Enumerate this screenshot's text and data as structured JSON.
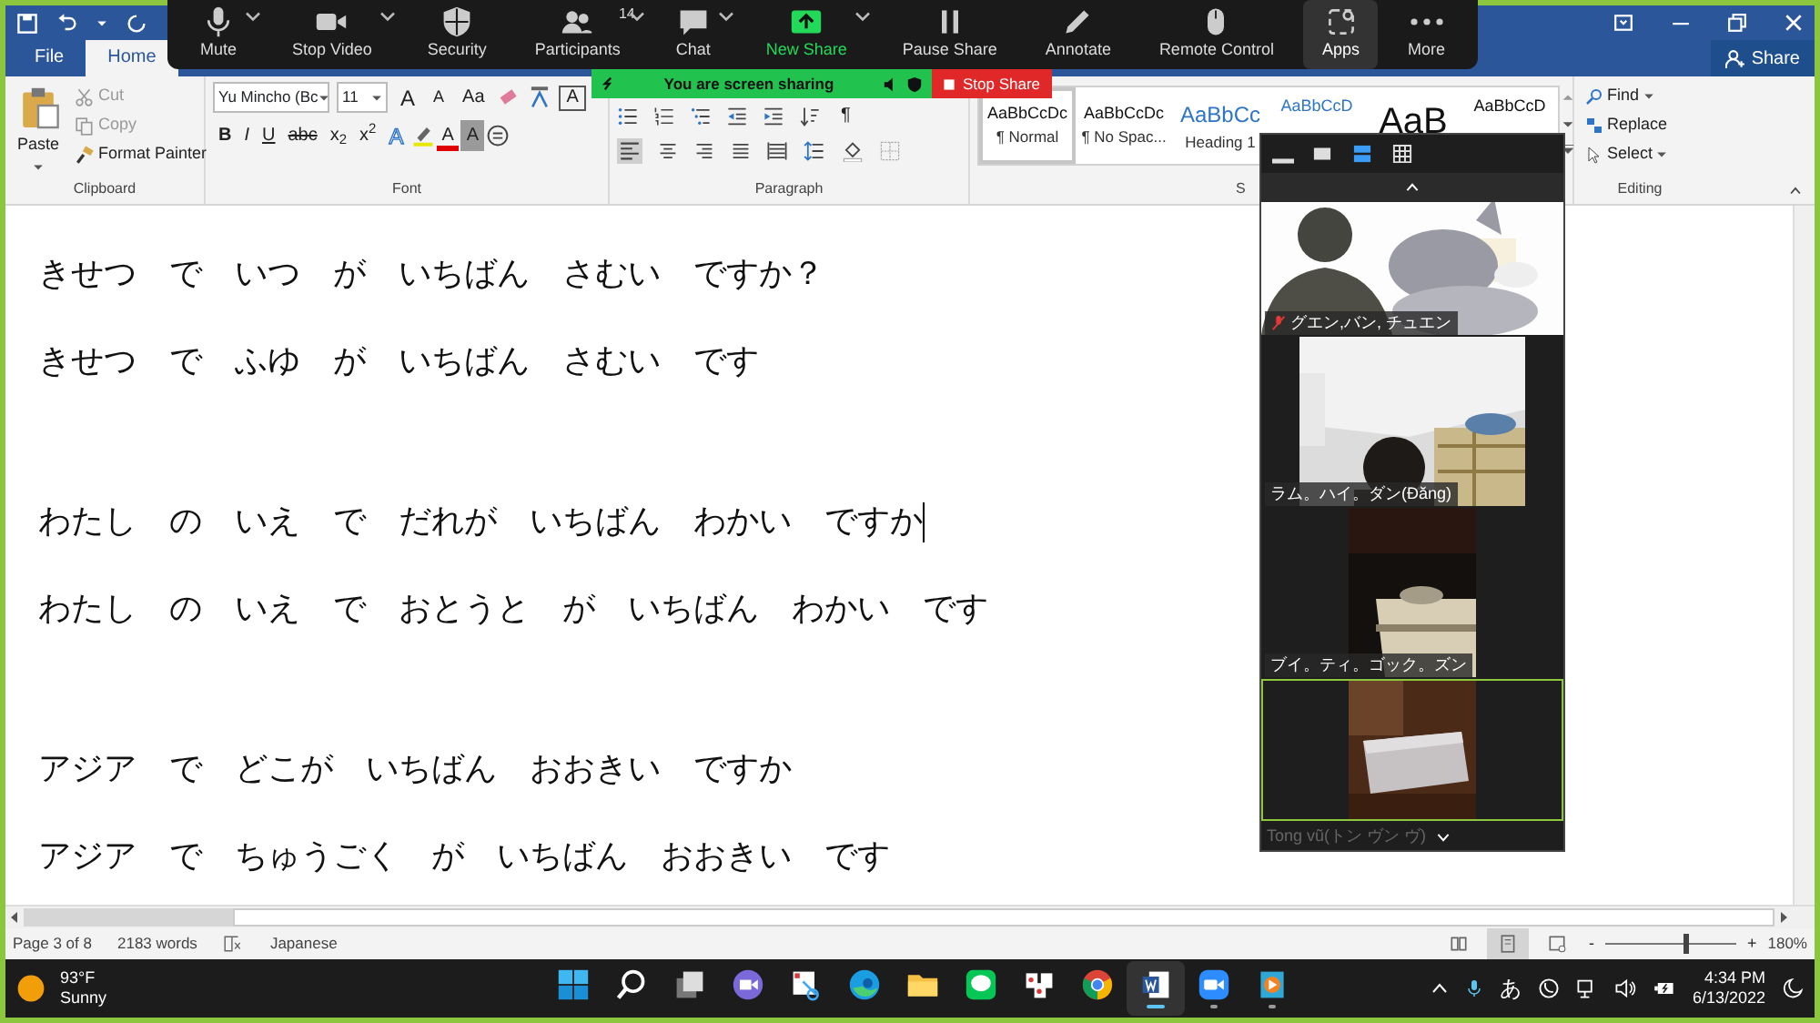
{
  "ribbon_tabs": [
    {
      "label": "File",
      "selected": false
    },
    {
      "label": "Home",
      "selected": true
    }
  ],
  "share_button": "Share",
  "clipboard": {
    "paste": "Paste",
    "label": "Clipboard",
    "commands": [
      {
        "label": "Cut",
        "kind": "cut",
        "disabled": true
      },
      {
        "label": "Copy",
        "kind": "copy",
        "disabled": true
      },
      {
        "label": "Format Painter",
        "kind": "painter",
        "disabled": false
      }
    ]
  },
  "font": {
    "name": "Yu Mincho (Bc",
    "size": "11",
    "label": "Font",
    "row1_buttons": [
      {
        "label": "A",
        "kind": "grow"
      },
      {
        "label": "A",
        "kind": "shrink"
      },
      {
        "label": "Aa",
        "kind": "case"
      },
      {
        "kind": "clear"
      },
      {
        "kind": "phonetic"
      },
      {
        "label": "A",
        "kind": "boxed"
      }
    ],
    "row2_buttons": [
      {
        "label": "B",
        "kind": "bold"
      },
      {
        "label": "I",
        "kind": "italic"
      },
      {
        "label": "U",
        "kind": "underline"
      },
      {
        "label": "abc",
        "kind": "strike"
      },
      {
        "label": "x$_{2}$",
        "kind": "script"
      },
      {
        "label": "x$^{2}$",
        "kind": "script"
      },
      {
        "label": "A",
        "kind": "effects"
      },
      {
        "kind": "highlight"
      },
      {
        "label": "A",
        "kind": "fontcolor"
      },
      {
        "label": "A",
        "kind": "shade"
      },
      {
        "kind": "enclose"
      }
    ]
  },
  "paragraph": {
    "label": "Paragraph",
    "show_marks": "¶"
  },
  "styles": {
    "label": "S",
    "items": [
      {
        "preview": "AaBbCcDc",
        "name": "¶ Normal",
        "selected": true
      },
      {
        "preview": "AaBbCcDc",
        "name": "¶ No Spac...",
        "selected": false
      },
      {
        "preview": "AaBbCc",
        "name": "Heading 1",
        "selected": false
      },
      {
        "preview": "AaBbCcD",
        "selected": false
      },
      {
        "preview": "AaB",
        "selected": false
      },
      {
        "preview": "AaBbCcD",
        "selected": false
      }
    ]
  },
  "editing": {
    "label": "Editing",
    "find": "Find",
    "replace": "Replace",
    "select": "Select"
  },
  "zoom_toolbar": [
    {
      "label": "Mute",
      "kind": "mic",
      "caret": true,
      "selected": false
    },
    {
      "label": "Stop Video",
      "kind": "camera",
      "caret": true,
      "selected": false
    },
    {
      "label": "Security",
      "kind": "shield",
      "caret": false,
      "selected": false
    },
    {
      "label": "Participants",
      "kind": "people",
      "caret": true,
      "selected": false,
      "count": "14"
    },
    {
      "label": "Chat",
      "kind": "chat",
      "caret": true,
      "selected": false
    },
    {
      "label": "New Share",
      "kind": "share",
      "caret": true,
      "selected": false
    },
    {
      "label": "Pause Share",
      "kind": "pause",
      "caret": false,
      "selected": false
    },
    {
      "label": "Annotate",
      "kind": "pencil",
      "caret": false,
      "selected": false
    },
    {
      "label": "Remote Control",
      "kind": "mouse",
      "caret": false,
      "selected": false
    },
    {
      "label": "Apps",
      "kind": "apps",
      "caret": false,
      "selected": true
    },
    {
      "label": "More",
      "kind": "more",
      "caret": false,
      "selected": false
    }
  ],
  "sharing_banner": {
    "text": "You are screen sharing",
    "stop_button": "Stop Share"
  },
  "video_panel": {
    "views": [
      {
        "kind": "minimize",
        "selected": false
      },
      {
        "kind": "thumbnail",
        "selected": false
      },
      {
        "kind": "speaker",
        "selected": true
      },
      {
        "kind": "gallery",
        "selected": false
      }
    ],
    "tiles": [
      {
        "name": "グエン,バン, チュエン",
        "muted": true,
        "active": false
      },
      {
        "name": "ラム。ハイ。ダン(Đăng)",
        "muted": false,
        "active": false
      },
      {
        "name": "ブイ。ティ。ゴック。ズン",
        "muted": false,
        "active": false
      },
      {
        "name": "Tong vũ(トン ヴン ヴ)",
        "muted": false,
        "active": true
      }
    ]
  },
  "document": {
    "groups": [
      {
        "lines": [
          {
            "text": "きせつ　で　いつ　が　いちばん　さむい　ですか？",
            "caret": false
          },
          {
            "text": "きせつ　で　ふゆ　が　いちばん　さむい　です",
            "caret": false
          }
        ]
      },
      {
        "lines": [
          {
            "text": "わたし　の　いえ　で　だれが　いちばん　わかい　ですか",
            "caret": true
          },
          {
            "text": "わたし　の　いえ　で　おとうと　が　いちばん　わかい　です",
            "caret": false
          }
        ]
      },
      {
        "lines": [
          {
            "text": "アジア　で　どこが　いちばん　おおきい　ですか",
            "caret": false
          },
          {
            "text": "アジア　で　ちゅうごく　が　いちばん　おおきい　です",
            "caret": false
          }
        ]
      }
    ]
  },
  "status_bar": {
    "page": "Page 3 of 8",
    "words": "2183 words",
    "language": "Japanese",
    "views": [
      {
        "kind": "read",
        "selected": false
      },
      {
        "kind": "print",
        "selected": true
      },
      {
        "kind": "web",
        "selected": false
      }
    ],
    "zoom_out": "-",
    "zoom_in": "+",
    "level": 0.6,
    "zoom": "180%"
  },
  "taskbar": {
    "weather": {
      "temperature": "93°F",
      "condition": "Sunny"
    },
    "apps": [
      {
        "kind": "start",
        "active": false,
        "running": false
      },
      {
        "kind": "search",
        "active": false,
        "running": false
      },
      {
        "kind": "taskview",
        "active": false,
        "running": false
      },
      {
        "kind": "meet",
        "active": false,
        "running": false
      },
      {
        "kind": "snip",
        "active": false,
        "running": false
      },
      {
        "kind": "edge",
        "active": false,
        "running": false
      },
      {
        "kind": "folder",
        "active": false,
        "running": false
      },
      {
        "kind": "line",
        "active": false,
        "running": false
      },
      {
        "kind": "cards",
        "active": false,
        "running": false
      },
      {
        "kind": "chrome",
        "active": false,
        "running": false
      },
      {
        "kind": "word",
        "active": true,
        "running": true
      },
      {
        "kind": "zoom",
        "active": false,
        "running": true
      },
      {
        "kind": "media",
        "active": false,
        "running": true
      }
    ],
    "ime": "あ",
    "time": "4:34 PM",
    "date": "6/13/2022"
  }
}
